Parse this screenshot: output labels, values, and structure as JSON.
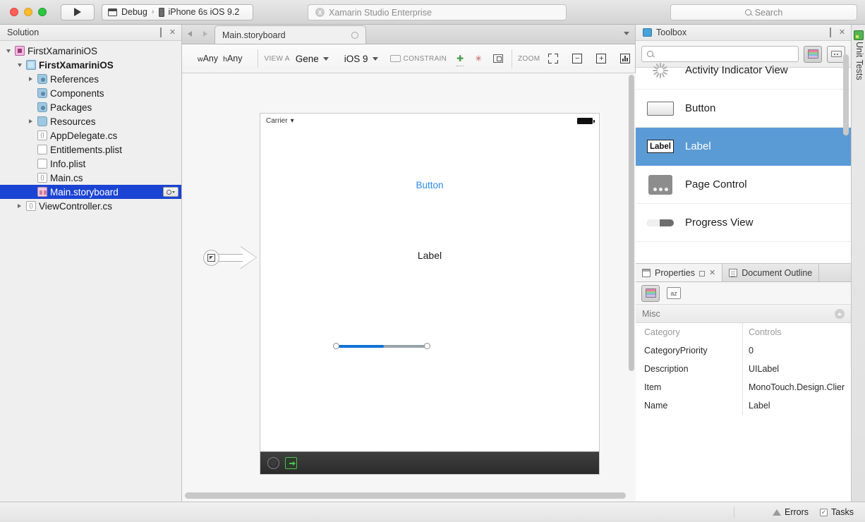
{
  "titlebar": {
    "run_label": "Run",
    "config": "Debug",
    "separator": "›",
    "device": "iPhone 6s iOS 9.2",
    "app_title": "Xamarin Studio Enterprise",
    "search_placeholder": "Search"
  },
  "solution": {
    "pad_title": "Solution",
    "items": [
      {
        "label": "FirstXamariniOS",
        "indent": 0,
        "twisty": "down",
        "icon": "solution-icon",
        "bold": false,
        "selected": false
      },
      {
        "label": "FirstXamariniOS",
        "indent": 1,
        "twisty": "down",
        "icon": "project-icon",
        "bold": true,
        "selected": false
      },
      {
        "label": "References",
        "indent": 2,
        "twisty": "right",
        "icon": "references-folder-icon",
        "bold": false,
        "selected": false
      },
      {
        "label": "Components",
        "indent": 2,
        "twisty": "none",
        "icon": "references-folder-icon",
        "bold": false,
        "selected": false
      },
      {
        "label": "Packages",
        "indent": 2,
        "twisty": "none",
        "icon": "references-folder-icon",
        "bold": false,
        "selected": false
      },
      {
        "label": "Resources",
        "indent": 2,
        "twisty": "right",
        "icon": "folder-icon",
        "bold": false,
        "selected": false
      },
      {
        "label": "AppDelegate.cs",
        "indent": 2,
        "twisty": "none",
        "icon": "csharp-file-icon",
        "bold": false,
        "selected": false
      },
      {
        "label": "Entitlements.plist",
        "indent": 2,
        "twisty": "none",
        "icon": "plist-file-icon",
        "bold": false,
        "selected": false
      },
      {
        "label": "Info.plist",
        "indent": 2,
        "twisty": "none",
        "icon": "plist-file-icon",
        "bold": false,
        "selected": false
      },
      {
        "label": "Main.cs",
        "indent": 2,
        "twisty": "none",
        "icon": "csharp-file-icon",
        "bold": false,
        "selected": false
      },
      {
        "label": "Main.storyboard",
        "indent": 2,
        "twisty": "none",
        "icon": "storyboard-file-icon",
        "bold": false,
        "selected": true
      },
      {
        "label": "ViewController.cs",
        "indent": 2,
        "twisty": "right",
        "icon": "csharp-file-icon",
        "bold": false,
        "selected": false
      }
    ]
  },
  "document": {
    "tab_name": "Main.storyboard",
    "designer_toolbar": {
      "size_class_w": "w",
      "size_class_w_val": "Any",
      "size_class_h": "h",
      "size_class_h_val": "Any",
      "view_as_label": "VIEW A",
      "view_as_value": "Gene",
      "os_value": "iOS 9",
      "constrain_label": "CONSTRAIN",
      "zoom_label": "ZOOM"
    }
  },
  "canvas": {
    "carrier": "Carrier",
    "wifi": "●",
    "button_text": "Button",
    "label_text": "Label",
    "progress_value": 52
  },
  "toolbox": {
    "pad_title": "Toolbox",
    "search_value": "",
    "items": [
      {
        "label": "Activity Indicator View",
        "icon": "activity-indicator-icon",
        "selected": false
      },
      {
        "label": "Button",
        "icon": "button-icon",
        "selected": false
      },
      {
        "label": "Label",
        "icon": "label-icon",
        "selected": true
      },
      {
        "label": "Page Control",
        "icon": "page-control-icon",
        "selected": false
      },
      {
        "label": "Progress View",
        "icon": "progress-view-icon",
        "selected": false
      }
    ]
  },
  "properties": {
    "tab_properties": "Properties",
    "tab_document_outline": "Document Outline",
    "group_header": "Misc",
    "rows": [
      {
        "name": "Category",
        "value": "Controls",
        "header": true
      },
      {
        "name": "CategoryPriority",
        "value": "0",
        "header": false
      },
      {
        "name": "Description",
        "value": "UILabel",
        "header": false
      },
      {
        "name": "Item",
        "value": "MonoTouch.Design.Clier",
        "header": false
      },
      {
        "name": "Name",
        "value": "Label",
        "header": false
      }
    ]
  },
  "right_edge": {
    "unit_tests": "Unit Tests"
  },
  "statusbar": {
    "errors": "Errors",
    "tasks": "Tasks"
  }
}
